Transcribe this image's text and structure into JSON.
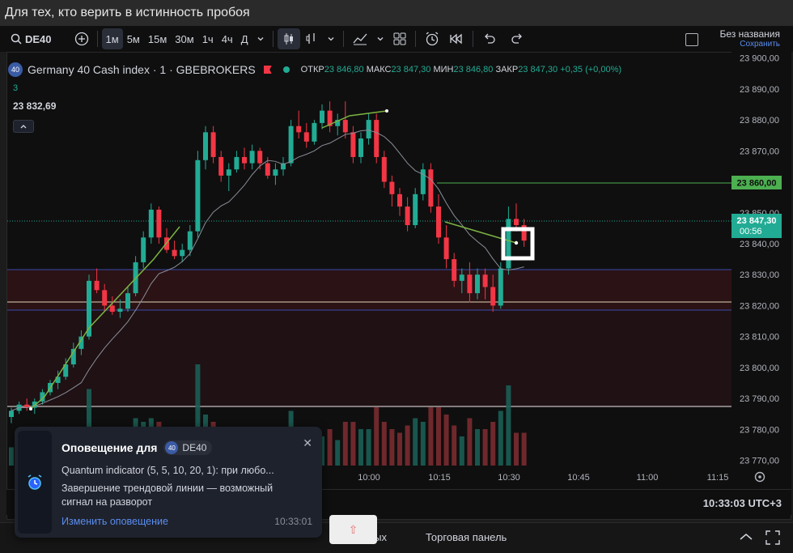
{
  "window": {
    "title": "Для тех, кто верить в истинность пробоя"
  },
  "toolbar": {
    "symbol": "DE40",
    "intervals": [
      "1м",
      "5м",
      "15м",
      "30м",
      "1ч",
      "4ч",
      "Д"
    ],
    "active_interval": "1м",
    "layout_name": "Без названия",
    "save_label": "Сохранить"
  },
  "legend": {
    "badge": "40",
    "title": "Germany 40 Cash index · 1 · GBEBROKERS",
    "open_label": "ОТКР",
    "open": "23 846,80",
    "high_label": "МАКС",
    "high": "23 847,30",
    "low_label": "МИН",
    "low": "23 846,80",
    "close_label": "ЗАКР",
    "close": "23 847,30",
    "change": "+0,35 (+0,00%)"
  },
  "indicator": {
    "length": "3",
    "value": "23 832,69"
  },
  "price_axis": {
    "ticks": [
      "23 900,00",
      "23 890,00",
      "23 880,00",
      "23 870,00",
      "23 860,00",
      "23 850,00",
      "23 840,00",
      "23 830,00",
      "23 820,00",
      "23 810,00",
      "23 800,00",
      "23 790,00",
      "23 780,00",
      "23 770,00"
    ],
    "alert_level": "23 860,00",
    "last_price": "23 847,30",
    "countdown": "00:56"
  },
  "time_axis": {
    "ticks": [
      "10:00",
      "10:15",
      "10:30",
      "10:45",
      "11:00",
      "11:15"
    ]
  },
  "clock": "10:33:03 UTC+3",
  "bottom_panel": {
    "tab_trading": "Торговая панель",
    "tab_partial": "ных"
  },
  "notification": {
    "title": "Оповещение для",
    "symbol_badge": "40",
    "symbol": "DE40",
    "line1": "Quantum indicator (5, 5, 10, 20, 1): при любо...",
    "line2": "Завершение трендовой линии — возможный",
    "line3": "сигнал на разворот",
    "link": "Изменить оповещение",
    "time": "10:33:01"
  },
  "colors": {
    "up": "#22ab94",
    "down": "#f23645",
    "background": "#0f0f0f"
  },
  "chart_data": {
    "type": "candlestick",
    "symbol": "DE40",
    "interval": "1m",
    "y_range": [
      23767,
      23902
    ],
    "candles": [
      [
        23784,
        23787,
        23782,
        23786
      ],
      [
        23786,
        23789,
        23785,
        23788
      ],
      [
        23788,
        23790,
        23786,
        23787
      ],
      [
        23787,
        23790,
        23785,
        23789
      ],
      [
        23789,
        23793,
        23788,
        23792
      ],
      [
        23792,
        23796,
        23791,
        23795
      ],
      [
        23795,
        23799,
        23793,
        23797
      ],
      [
        23797,
        23803,
        23796,
        23801
      ],
      [
        23801,
        23808,
        23800,
        23806
      ],
      [
        23806,
        23812,
        23804,
        23810
      ],
      [
        23810,
        23830,
        23809,
        23828
      ],
      [
        23828,
        23832,
        23824,
        23825
      ],
      [
        23825,
        23827,
        23818,
        23820
      ],
      [
        23820,
        23823,
        23817,
        23818
      ],
      [
        23818,
        23822,
        23816,
        23819
      ],
      [
        23819,
        23826,
        23818,
        23824
      ],
      [
        23824,
        23836,
        23823,
        23834
      ],
      [
        23834,
        23844,
        23832,
        23842
      ],
      [
        23842,
        23853,
        23840,
        23851
      ],
      [
        23851,
        23852,
        23840,
        23842
      ],
      [
        23842,
        23845,
        23837,
        23838
      ],
      [
        23838,
        23841,
        23835,
        23836
      ],
      [
        23836,
        23840,
        23834,
        23838
      ],
      [
        23838,
        23846,
        23836,
        23844
      ],
      [
        23844,
        23870,
        23842,
        23867
      ],
      [
        23867,
        23878,
        23864,
        23876
      ],
      [
        23876,
        23878,
        23866,
        23868
      ],
      [
        23868,
        23870,
        23860,
        23862
      ],
      [
        23862,
        23866,
        23857,
        23864
      ],
      [
        23864,
        23870,
        23863,
        23868
      ],
      [
        23868,
        23871,
        23864,
        23866
      ],
      [
        23866,
        23872,
        23864,
        23870
      ],
      [
        23870,
        23871,
        23864,
        23866
      ],
      [
        23866,
        23868,
        23861,
        23862
      ],
      [
        23862,
        23866,
        23859,
        23864
      ],
      [
        23864,
        23868,
        23862,
        23866
      ],
      [
        23866,
        23880,
        23865,
        23878
      ],
      [
        23878,
        23883,
        23874,
        23876
      ],
      [
        23876,
        23879,
        23871,
        23873
      ],
      [
        23873,
        23880,
        23872,
        23879
      ],
      [
        23879,
        23885,
        23877,
        23883
      ],
      [
        23883,
        23886,
        23876,
        23878
      ],
      [
        23878,
        23882,
        23875,
        23880
      ],
      [
        23880,
        23886,
        23874,
        23876
      ],
      [
        23876,
        23878,
        23866,
        23868
      ],
      [
        23868,
        23876,
        23866,
        23874
      ],
      [
        23874,
        23882,
        23872,
        23880
      ],
      [
        23880,
        23882,
        23866,
        23868
      ],
      [
        23868,
        23870,
        23858,
        23860
      ],
      [
        23860,
        23862,
        23852,
        23856
      ],
      [
        23856,
        23858,
        23849,
        23852
      ],
      [
        23852,
        23855,
        23844,
        23846
      ],
      [
        23846,
        23858,
        23845,
        23856
      ],
      [
        23856,
        23866,
        23854,
        23864
      ],
      [
        23864,
        23866,
        23850,
        23852
      ],
      [
        23852,
        23856,
        23840,
        23842
      ],
      [
        23842,
        23846,
        23832,
        23835
      ],
      [
        23835,
        23837,
        23826,
        23828
      ],
      [
        23828,
        23832,
        23824,
        23830
      ],
      [
        23830,
        23834,
        23821,
        23824
      ],
      [
        23824,
        23832,
        23822,
        23830
      ],
      [
        23830,
        23832,
        23822,
        23826
      ],
      [
        23826,
        23830,
        23818,
        23820
      ],
      [
        23820,
        23834,
        23819,
        23832
      ],
      [
        23832,
        23852,
        23830,
        23848
      ],
      [
        23848,
        23853,
        23844,
        23846
      ],
      [
        23846,
        23848,
        23839,
        23841
      ]
    ]
  }
}
